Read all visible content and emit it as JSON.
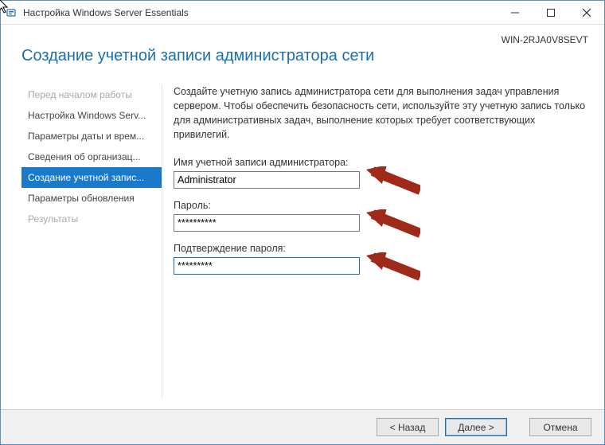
{
  "window": {
    "title": "Настройка Windows Server Essentials",
    "machine": "WIN-2RJA0V8SEVT"
  },
  "heading": "Создание учетной записи администратора сети",
  "nav": {
    "items": [
      {
        "label": "Перед началом работы",
        "state": "disabled"
      },
      {
        "label": "Настройка Windows Serv...",
        "state": "normal"
      },
      {
        "label": "Параметры даты и врем...",
        "state": "normal"
      },
      {
        "label": "Сведения об организац...",
        "state": "normal"
      },
      {
        "label": "Создание учетной запис...",
        "state": "active"
      },
      {
        "label": "Параметры обновления",
        "state": "normal"
      },
      {
        "label": "Результаты",
        "state": "disabled"
      }
    ]
  },
  "content": {
    "description": "Создайте учетную запись администратора сети для выполнения задач управления сервером. Чтобы обеспечить безопасность сети, используйте эту учетную запись только для административных задач, выполнение которых требует соответствующих привилегий.",
    "fields": {
      "username_label": "Имя учетной записи администратора:",
      "username_value": "Administrator",
      "password_label": "Пароль:",
      "password_value": "**********",
      "confirm_label": "Подтверждение пароля:",
      "confirm_value": "*********"
    }
  },
  "footer": {
    "back": "< Назад",
    "next": "Далее >",
    "cancel": "Отмена"
  }
}
